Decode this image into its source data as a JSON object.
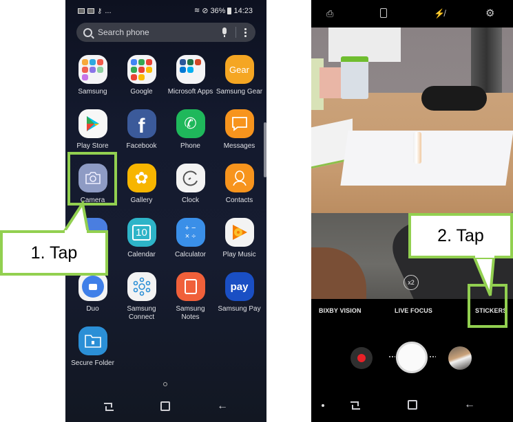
{
  "left_phone": {
    "status_bar": {
      "left_icons": [
        "gallery-notification",
        "gallery-notification",
        "key-icon"
      ],
      "overflow": "...",
      "battery_percent": "36%",
      "time": "14:23"
    },
    "search": {
      "placeholder": "Search phone"
    },
    "apps": [
      {
        "label": "Samsung",
        "icon": "samsung-folder"
      },
      {
        "label": "Google",
        "icon": "google-folder"
      },
      {
        "label": "Microsoft Apps",
        "icon": "microsoft-folder"
      },
      {
        "label": "Samsung Gear",
        "icon": "gear-app",
        "icon_text": "Gear",
        "color": "#f5a623"
      },
      {
        "label": "Play Store",
        "icon": "play-store"
      },
      {
        "label": "Facebook",
        "icon": "facebook",
        "icon_text": "f",
        "color": "#3b5a9a"
      },
      {
        "label": "Phone",
        "icon": "phone",
        "color": "#1fb85b"
      },
      {
        "label": "Messages",
        "icon": "messages",
        "color": "#f7941d"
      },
      {
        "label": "Camera",
        "icon": "camera",
        "color": "#8e9bc4"
      },
      {
        "label": "Gallery",
        "icon": "gallery",
        "color": "#f7b500"
      },
      {
        "label": "Clock",
        "icon": "clock",
        "color": "#f3f3f3"
      },
      {
        "label": "Contacts",
        "icon": "contacts",
        "color": "#f7941d"
      },
      {
        "label": "",
        "icon": "hidden-app",
        "color": "#4a7ee0"
      },
      {
        "label": "Calendar",
        "icon": "calendar",
        "icon_text": "10",
        "color": "#2eb4c8"
      },
      {
        "label": "Calculator",
        "icon": "calculator",
        "icon_text": "+ −\n× ÷",
        "color": "#3a8fe8"
      },
      {
        "label": "Play Music",
        "icon": "play-music",
        "color": "#f3f3f3"
      },
      {
        "label": "Duo",
        "icon": "duo",
        "color": "#f3f3f3"
      },
      {
        "label": "Samsung Connect",
        "icon": "samsung-connect",
        "color": "#f3f3f3"
      },
      {
        "label": "Samsung Notes",
        "icon": "samsung-notes",
        "color": "#f0603a"
      },
      {
        "label": "Samsung Pay",
        "icon": "samsung-pay",
        "icon_text": "pay",
        "color": "#1a4fc4"
      },
      {
        "label": "Secure Folder",
        "icon": "secure-folder",
        "color": "#2b8fd6"
      }
    ],
    "callout": {
      "text": "1. Tap"
    }
  },
  "right_phone": {
    "top_icons": [
      "switch-camera-icon",
      "aspect-ratio-icon",
      "flash-off-icon",
      "settings-icon"
    ],
    "zoom_badge": "x2",
    "modes": [
      "BIXBY VISION",
      "LIVE FOCUS",
      "STICKERS"
    ],
    "callout": {
      "text": "2. Tap"
    }
  },
  "colors": {
    "highlight": "#92d050",
    "record": "#e82127"
  }
}
